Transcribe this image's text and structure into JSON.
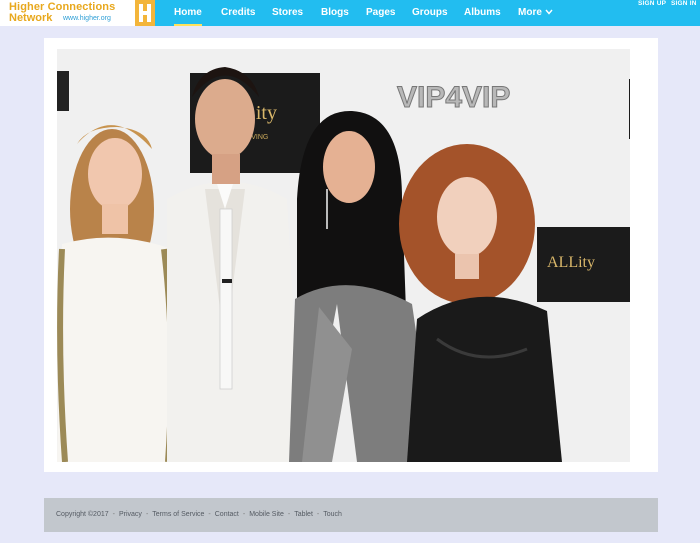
{
  "logo": {
    "line1": "Higher Connections",
    "line2": "Network",
    "url": "www.higher.org"
  },
  "nav": {
    "items": [
      {
        "label": "Home"
      },
      {
        "label": "Credits"
      },
      {
        "label": "Stores"
      },
      {
        "label": "Blogs"
      },
      {
        "label": "Pages"
      },
      {
        "label": "Groups"
      },
      {
        "label": "Albums"
      },
      {
        "label": "More"
      }
    ],
    "active": "Home",
    "sign_up": "SIGN UP",
    "sign_in": "SIGN IN"
  },
  "photo": {
    "backdrop_text_1": "VIP4VIP",
    "backdrop_text_2": "ALLity",
    "backdrop_text_3": "CONNECT LIVING",
    "backdrop_text_4": "VIP4VIP"
  },
  "footer": {
    "copyright": "Copyright ©2017",
    "links": [
      "Privacy",
      "Terms of Service",
      "Contact",
      "Mobile Site",
      "Tablet",
      "Touch"
    ]
  },
  "colors": {
    "nav_bg": "#22bdf0",
    "page_bg": "#e6e8f9",
    "logo_accent": "#e8a81d",
    "active_underline": "#ffe25c",
    "footer_bg": "#c2c7cd"
  }
}
